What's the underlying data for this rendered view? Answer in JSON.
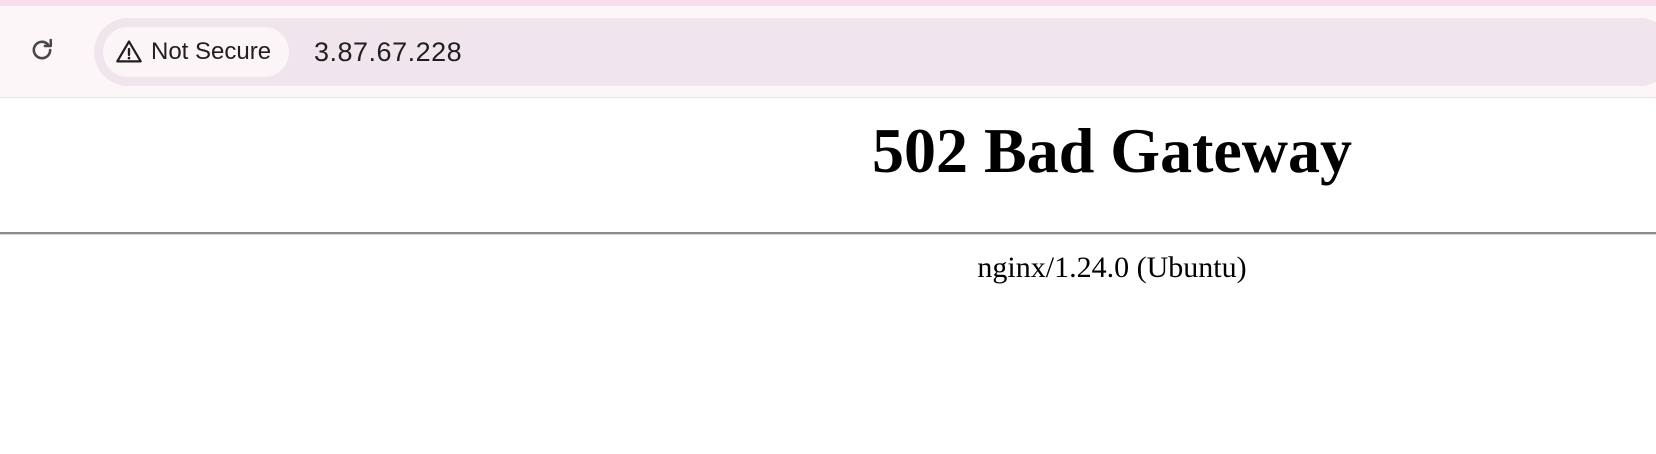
{
  "browser": {
    "reload_icon": "reload-icon",
    "security": {
      "icon": "warning-triangle-icon",
      "label": "Not Secure"
    },
    "url": "3.87.67.228"
  },
  "page": {
    "title": "502 Bad Gateway",
    "server": "nginx/1.24.0 (Ubuntu)"
  },
  "colors": {
    "top_strip": "#f6dde9",
    "toolbar_bg": "#fcf6f8",
    "omnibox_bg": "#f0e5ec",
    "chip_bg": "#fbf5f8"
  }
}
